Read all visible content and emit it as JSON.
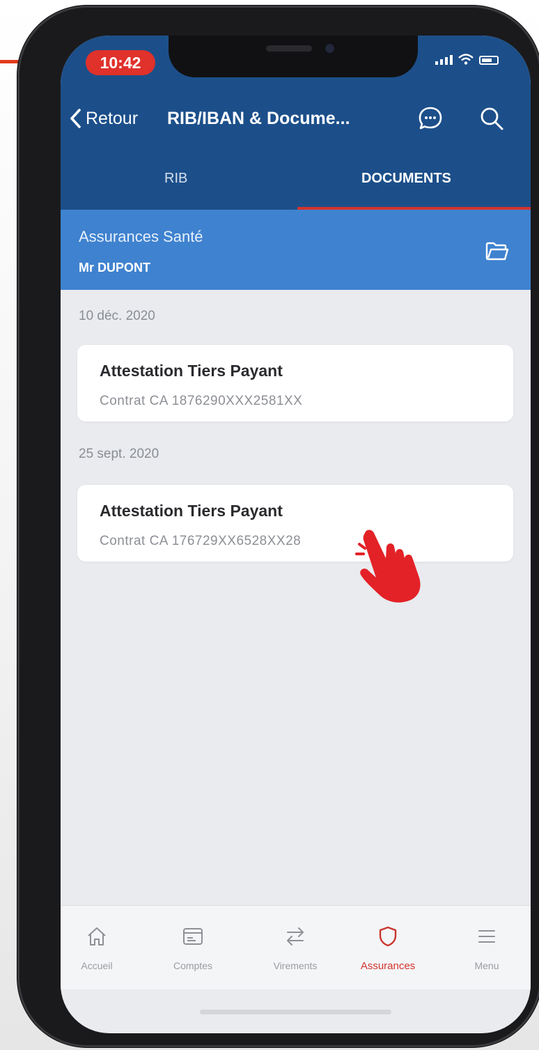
{
  "status_bar": {
    "time": "10:42"
  },
  "header": {
    "back_label": "Retour",
    "title": "RIB/IBAN & Docume...",
    "tabs": [
      {
        "label": "RIB",
        "active": false
      },
      {
        "label": "DOCUMENTS",
        "active": true
      }
    ]
  },
  "account": {
    "title": "Assurances Santé",
    "owner": "Mr DUPONT"
  },
  "documents": [
    {
      "date": "10 déc. 2020",
      "title": "Attestation Tiers Payant",
      "subtitle": "Contrat CA 1876290XXX2581XX"
    },
    {
      "date": "25 sept. 2020",
      "title": "Attestation Tiers Payant",
      "subtitle": "Contrat CA  176729XX6528XX28"
    }
  ],
  "bottom_nav": [
    {
      "label": "Accueil",
      "icon": "home-icon",
      "active": false
    },
    {
      "label": "Comptes",
      "icon": "card-icon",
      "active": false
    },
    {
      "label": "Virements",
      "icon": "transfer-icon",
      "active": false
    },
    {
      "label": "Assurances",
      "icon": "shield-icon",
      "active": true
    },
    {
      "label": "Menu",
      "icon": "menu-icon",
      "active": false
    }
  ],
  "colors": {
    "header": "#1c4f8a",
    "account_bar": "#3f82cf",
    "accent": "#d3342e",
    "time_pill": "#e0312b",
    "hand_pointer": "#e32227"
  }
}
